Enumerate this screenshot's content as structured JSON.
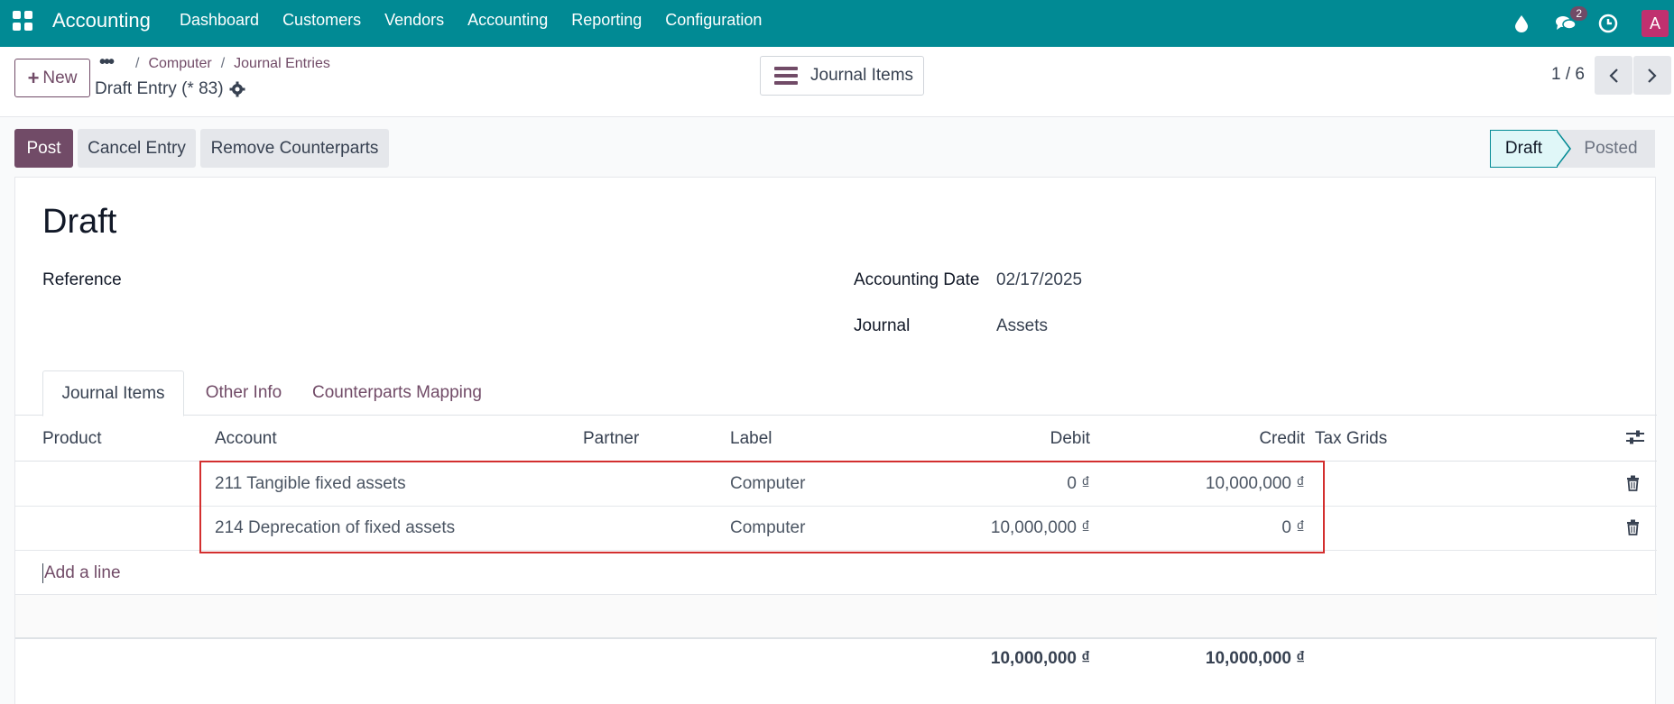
{
  "nav": {
    "app_name": "Accounting",
    "menu": [
      "Dashboard",
      "Customers",
      "Vendors",
      "Accounting",
      "Reporting",
      "Configuration"
    ],
    "message_badge": "2",
    "avatar_letter": "A"
  },
  "control_panel": {
    "new_label": "New",
    "breadcrumbs": [
      "Computer",
      "Journal Entries"
    ],
    "record_name": "Draft Entry (* 83)",
    "view_label": "Journal Items",
    "pager": "1 / 6"
  },
  "actions": {
    "post": "Post",
    "cancel": "Cancel Entry",
    "remove": "Remove Counterparts"
  },
  "status": {
    "current": "Draft",
    "next": "Posted"
  },
  "form": {
    "title": "Draft",
    "reference_label": "Reference",
    "accounting_date_label": "Accounting Date",
    "accounting_date": "02/17/2025",
    "journal_label": "Journal",
    "journal": "Assets"
  },
  "tabs": [
    "Journal Items",
    "Other Info",
    "Counterparts Mapping"
  ],
  "table": {
    "columns": {
      "product": "Product",
      "account": "Account",
      "partner": "Partner",
      "label": "Label",
      "debit": "Debit",
      "credit": "Credit",
      "tax_grids": "Tax Grids"
    },
    "rows": [
      {
        "account": "211 Tangible fixed assets",
        "label": "Computer",
        "debit": "0 ₫",
        "credit": "10,000,000 ₫"
      },
      {
        "account": "214 Deprecation of fixed assets",
        "label": "Computer",
        "debit": "10,000,000 ₫",
        "credit": "0 ₫"
      }
    ],
    "add_line": "Add a line",
    "total_debit": "10,000,000 ₫",
    "total_credit": "10,000,000 ₫"
  },
  "colors": {
    "navbar": "#018a94",
    "primary": "#714B67",
    "highlight": "#d32f2f"
  }
}
